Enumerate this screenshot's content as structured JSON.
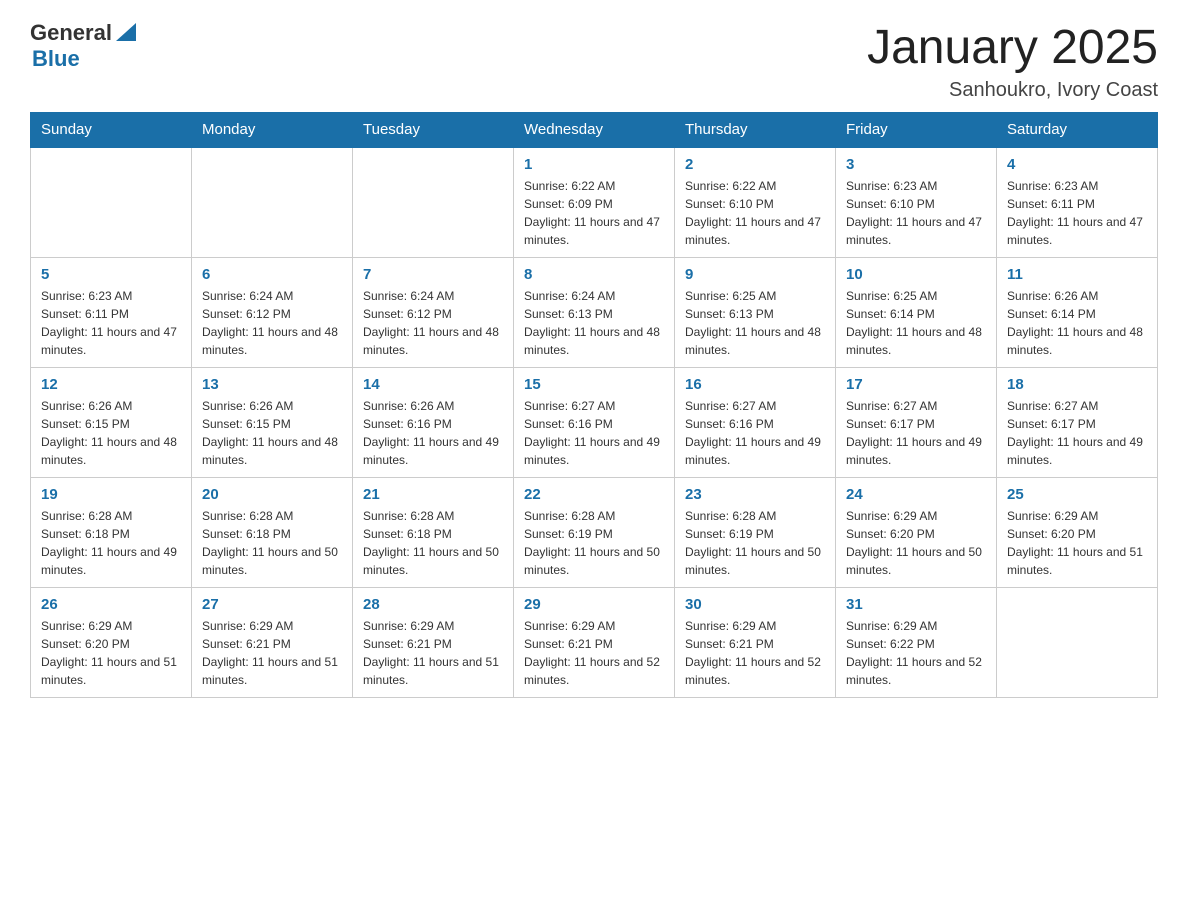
{
  "header": {
    "logo_general": "General",
    "logo_blue": "Blue",
    "month_title": "January 2025",
    "location": "Sanhoukro, Ivory Coast"
  },
  "days_of_week": [
    "Sunday",
    "Monday",
    "Tuesday",
    "Wednesday",
    "Thursday",
    "Friday",
    "Saturday"
  ],
  "weeks": [
    [
      {
        "day": "",
        "info": ""
      },
      {
        "day": "",
        "info": ""
      },
      {
        "day": "",
        "info": ""
      },
      {
        "day": "1",
        "info": "Sunrise: 6:22 AM\nSunset: 6:09 PM\nDaylight: 11 hours and 47 minutes."
      },
      {
        "day": "2",
        "info": "Sunrise: 6:22 AM\nSunset: 6:10 PM\nDaylight: 11 hours and 47 minutes."
      },
      {
        "day": "3",
        "info": "Sunrise: 6:23 AM\nSunset: 6:10 PM\nDaylight: 11 hours and 47 minutes."
      },
      {
        "day": "4",
        "info": "Sunrise: 6:23 AM\nSunset: 6:11 PM\nDaylight: 11 hours and 47 minutes."
      }
    ],
    [
      {
        "day": "5",
        "info": "Sunrise: 6:23 AM\nSunset: 6:11 PM\nDaylight: 11 hours and 47 minutes."
      },
      {
        "day": "6",
        "info": "Sunrise: 6:24 AM\nSunset: 6:12 PM\nDaylight: 11 hours and 48 minutes."
      },
      {
        "day": "7",
        "info": "Sunrise: 6:24 AM\nSunset: 6:12 PM\nDaylight: 11 hours and 48 minutes."
      },
      {
        "day": "8",
        "info": "Sunrise: 6:24 AM\nSunset: 6:13 PM\nDaylight: 11 hours and 48 minutes."
      },
      {
        "day": "9",
        "info": "Sunrise: 6:25 AM\nSunset: 6:13 PM\nDaylight: 11 hours and 48 minutes."
      },
      {
        "day": "10",
        "info": "Sunrise: 6:25 AM\nSunset: 6:14 PM\nDaylight: 11 hours and 48 minutes."
      },
      {
        "day": "11",
        "info": "Sunrise: 6:26 AM\nSunset: 6:14 PM\nDaylight: 11 hours and 48 minutes."
      }
    ],
    [
      {
        "day": "12",
        "info": "Sunrise: 6:26 AM\nSunset: 6:15 PM\nDaylight: 11 hours and 48 minutes."
      },
      {
        "day": "13",
        "info": "Sunrise: 6:26 AM\nSunset: 6:15 PM\nDaylight: 11 hours and 48 minutes."
      },
      {
        "day": "14",
        "info": "Sunrise: 6:26 AM\nSunset: 6:16 PM\nDaylight: 11 hours and 49 minutes."
      },
      {
        "day": "15",
        "info": "Sunrise: 6:27 AM\nSunset: 6:16 PM\nDaylight: 11 hours and 49 minutes."
      },
      {
        "day": "16",
        "info": "Sunrise: 6:27 AM\nSunset: 6:16 PM\nDaylight: 11 hours and 49 minutes."
      },
      {
        "day": "17",
        "info": "Sunrise: 6:27 AM\nSunset: 6:17 PM\nDaylight: 11 hours and 49 minutes."
      },
      {
        "day": "18",
        "info": "Sunrise: 6:27 AM\nSunset: 6:17 PM\nDaylight: 11 hours and 49 minutes."
      }
    ],
    [
      {
        "day": "19",
        "info": "Sunrise: 6:28 AM\nSunset: 6:18 PM\nDaylight: 11 hours and 49 minutes."
      },
      {
        "day": "20",
        "info": "Sunrise: 6:28 AM\nSunset: 6:18 PM\nDaylight: 11 hours and 50 minutes."
      },
      {
        "day": "21",
        "info": "Sunrise: 6:28 AM\nSunset: 6:18 PM\nDaylight: 11 hours and 50 minutes."
      },
      {
        "day": "22",
        "info": "Sunrise: 6:28 AM\nSunset: 6:19 PM\nDaylight: 11 hours and 50 minutes."
      },
      {
        "day": "23",
        "info": "Sunrise: 6:28 AM\nSunset: 6:19 PM\nDaylight: 11 hours and 50 minutes."
      },
      {
        "day": "24",
        "info": "Sunrise: 6:29 AM\nSunset: 6:20 PM\nDaylight: 11 hours and 50 minutes."
      },
      {
        "day": "25",
        "info": "Sunrise: 6:29 AM\nSunset: 6:20 PM\nDaylight: 11 hours and 51 minutes."
      }
    ],
    [
      {
        "day": "26",
        "info": "Sunrise: 6:29 AM\nSunset: 6:20 PM\nDaylight: 11 hours and 51 minutes."
      },
      {
        "day": "27",
        "info": "Sunrise: 6:29 AM\nSunset: 6:21 PM\nDaylight: 11 hours and 51 minutes."
      },
      {
        "day": "28",
        "info": "Sunrise: 6:29 AM\nSunset: 6:21 PM\nDaylight: 11 hours and 51 minutes."
      },
      {
        "day": "29",
        "info": "Sunrise: 6:29 AM\nSunset: 6:21 PM\nDaylight: 11 hours and 52 minutes."
      },
      {
        "day": "30",
        "info": "Sunrise: 6:29 AM\nSunset: 6:21 PM\nDaylight: 11 hours and 52 minutes."
      },
      {
        "day": "31",
        "info": "Sunrise: 6:29 AM\nSunset: 6:22 PM\nDaylight: 11 hours and 52 minutes."
      },
      {
        "day": "",
        "info": ""
      }
    ]
  ]
}
